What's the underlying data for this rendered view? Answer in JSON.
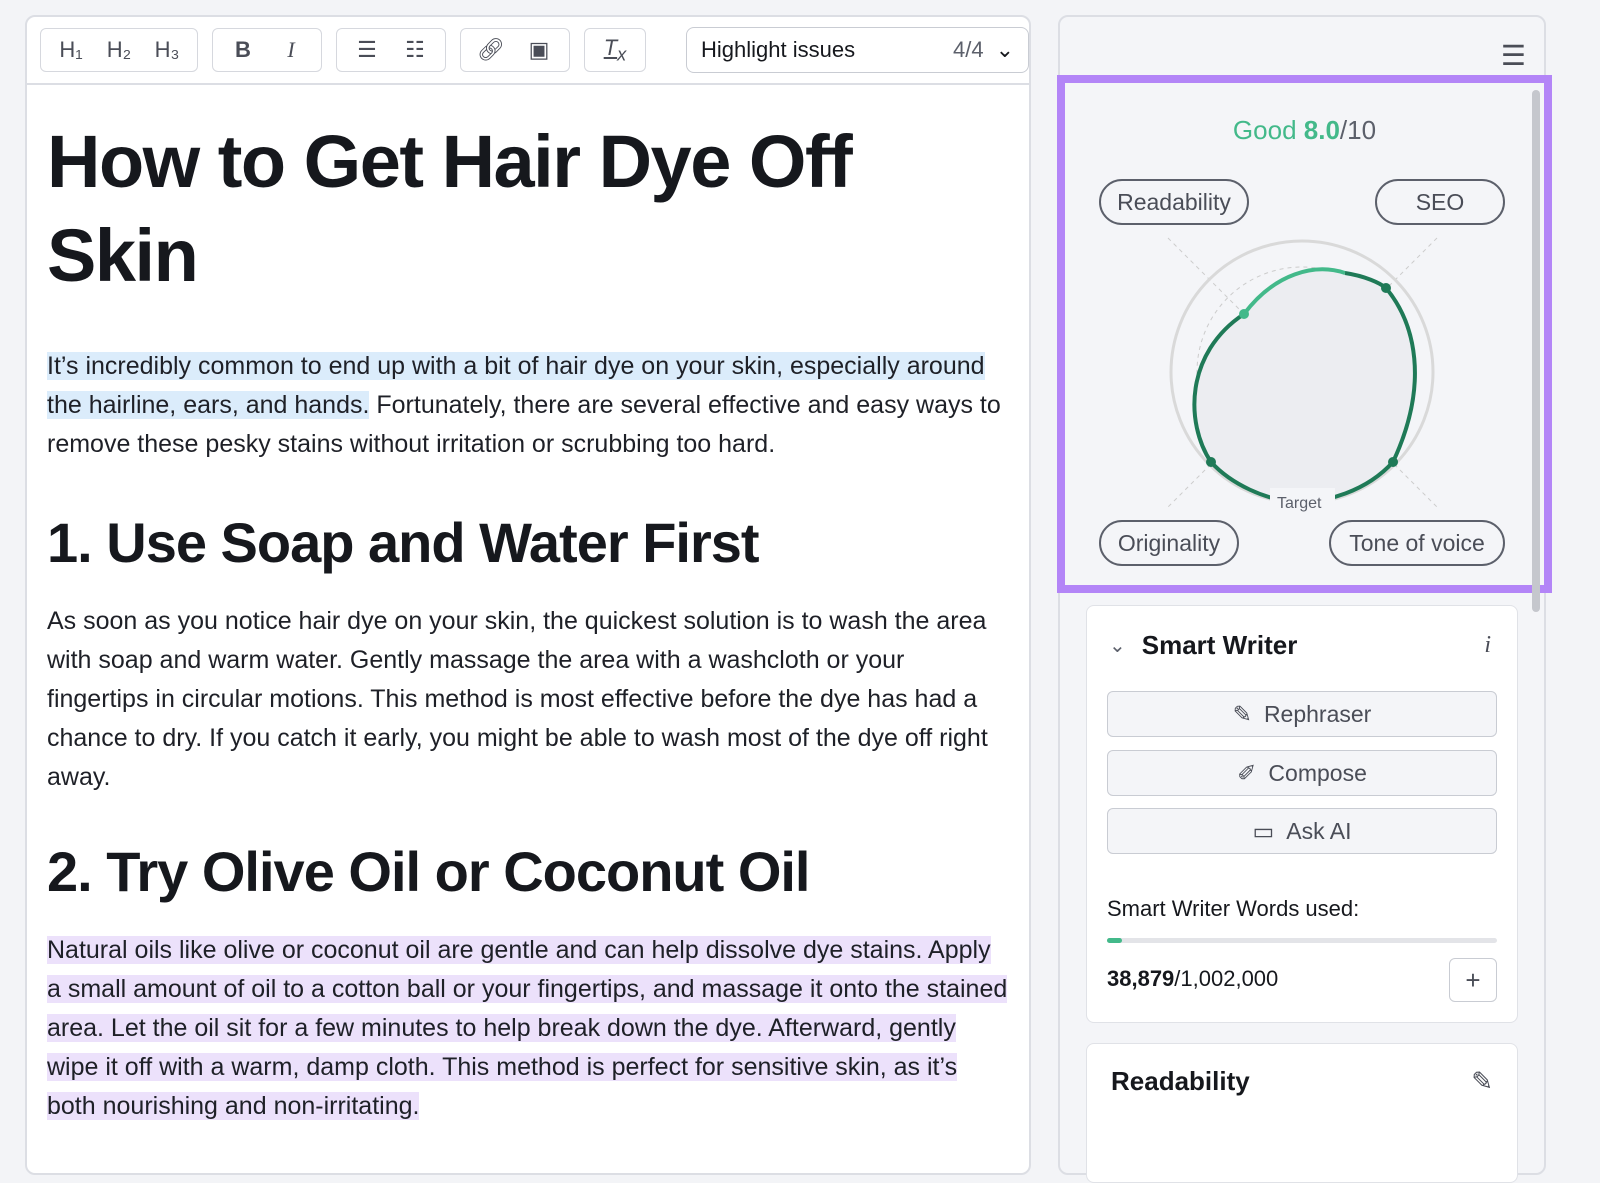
{
  "toolbar": {
    "h1": "H₁",
    "h2": "H₂",
    "h3": "H₃",
    "bold": "B",
    "italic": "I",
    "highlight_label": "Highlight issues",
    "highlight_count": "4/4"
  },
  "doc": {
    "title": "How to Get Hair Dye Off Skin",
    "p1_highlight": "It’s incredibly common to end up with a bit of hair dye on your skin, especially around the hairline, ears, and hands.",
    "p1_rest": " Fortunately, there are several effective and easy ways to remove these pesky stains without irritation or scrubbing too hard.",
    "h2_1": "1. Use Soap and Water First",
    "p2": "As soon as you notice hair dye on your skin, the quickest solution is to wash the area with soap and warm water. Gently massage the area with a washcloth or your fingertips in circular motions. This method is most effective before the dye has had a chance to dry. If you catch it early, you might be able to wash most of the dye off right away.",
    "h2_2": "2. Try Olive Oil or Coconut Oil",
    "p3": "Natural oils like olive or coconut oil are gentle and can help dissolve dye stains. Apply a small amount of oil to a cotton ball or your fingertips, and massage it onto the stained area. Let the oil sit for a few minutes to help break down the dye. Afterward, gently wipe it off with a warm, damp cloth. This method is perfect for sensitive skin, as it’s both nourishing and non-irritating."
  },
  "score": {
    "rating": "Good",
    "value": "8.0",
    "max": "/10",
    "target_label": "Target",
    "axes": [
      "Readability",
      "SEO",
      "Tone of voice",
      "Originality"
    ],
    "colors": {
      "good": "#43b98a",
      "dark": "#1f7a57",
      "highlight": "#b385f7"
    }
  },
  "smart_writer": {
    "title": "Smart Writer",
    "buttons": [
      "Rephraser",
      "Compose",
      "Ask AI"
    ],
    "words_label": "Smart Writer Words used:",
    "used": "38,879",
    "total": "/1,002,000",
    "usage_fraction": 0.039
  },
  "readability": {
    "title": "Readability"
  }
}
